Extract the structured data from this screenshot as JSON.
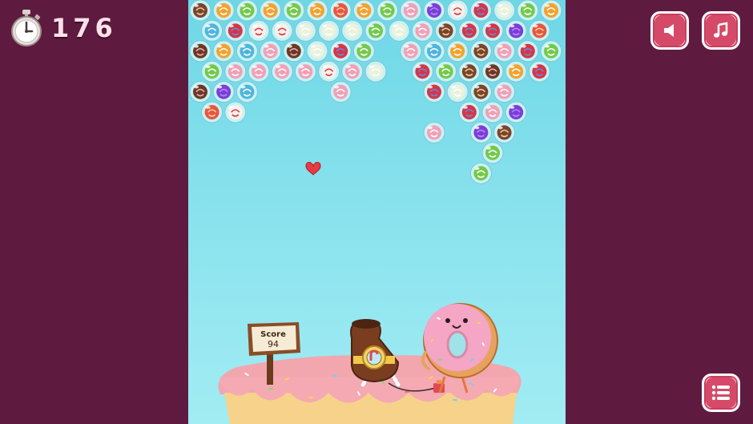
{
  "hud": {
    "timer_value": "176",
    "timer_icon": "stopwatch-icon"
  },
  "buttons": {
    "sound": "speaker-icon",
    "music": "music-note-icon",
    "menu": "list-menu-icon"
  },
  "score": {
    "label": "Score",
    "value": "94"
  },
  "colors": {
    "background": "#5e1b3f",
    "sky": "#8ee4ef",
    "button_accent": "#d44a68"
  },
  "candies": {
    "cherry": "cherry-candy",
    "orange": "orange-slice-candy",
    "mint": "green-swirl-candy",
    "peach": "red-swirl-candy",
    "pink": "pink-striped-candy",
    "purple": "purple-candy",
    "cane": "candy-cane",
    "cream": "cream-striped-candy",
    "donut": "chocolate-donut-candy",
    "blue": "blue-swirl-candy",
    "choco": "chocolate-cookie-candy",
    "wrap": "wrapped-candy"
  },
  "bubble_grid": [
    [
      "choco",
      "orange",
      "mint",
      "orange",
      "mint",
      "orange",
      "peach",
      "orange",
      "mint",
      "pink",
      "purple",
      "cane",
      "wrap",
      "cream",
      "mint",
      "orange"
    ],
    [
      "blue",
      "wrap",
      "cane",
      "cane",
      "cream",
      "cream",
      "cream",
      "mint",
      "cream",
      "pink",
      "choco",
      "wrap",
      "wrap",
      "purple",
      "peach"
    ],
    [
      "donut",
      "orange",
      "blue",
      "pink",
      "donut",
      "cream",
      "wrap",
      "mint",
      "",
      "pink",
      "blue",
      "orange",
      "choco",
      "pink",
      "wrap",
      "mint"
    ],
    [
      "mint",
      "pink",
      "pink",
      "pink",
      "pink",
      "cane",
      "pink",
      "cream",
      "",
      "wrap",
      "mint",
      "choco",
      "donut",
      "orange",
      "wrap"
    ],
    [
      "donut",
      "purple",
      "blue",
      "",
      "",
      "",
      "pink",
      "",
      "",
      "",
      "wrap",
      "cream",
      "choco",
      "pink"
    ],
    [
      "peach",
      "cane",
      "",
      "",
      "",
      "",
      "",
      "",
      "",
      "",
      "",
      "wrap",
      "pink",
      "purple"
    ],
    [
      "",
      "",
      "",
      "",
      "",
      "",
      "",
      "",
      "",
      "",
      "pink",
      "",
      "purple",
      "choco"
    ],
    [
      "",
      "",
      "",
      "",
      "",
      "",
      "",
      "",
      "",
      "",
      "",
      "",
      "mint"
    ],
    [
      "",
      "",
      "",
      "",
      "",
      "",
      "",
      "",
      "",
      "",
      "",
      "",
      "mint"
    ]
  ]
}
